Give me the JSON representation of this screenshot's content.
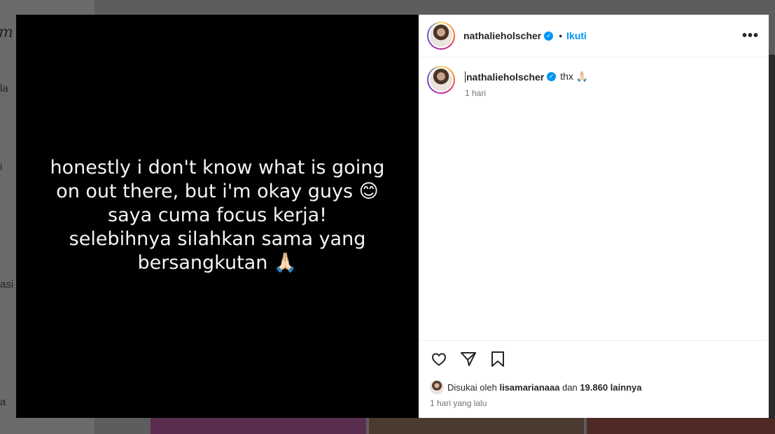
{
  "background": {
    "logo_fragment": "m",
    "nav_fragments": [
      "la",
      "i",
      "asi",
      "a"
    ]
  },
  "media": {
    "story_lines": [
      "honestly i don't know what is going",
      "on out there, but i'm okay guys 😊",
      "saya cuma focus kerja!",
      "selebihnya silahkan sama yang",
      "bersangkutan 🙏🏻"
    ]
  },
  "post": {
    "username": "nathalieholscher",
    "verified": true,
    "follow_label": "Ikuti",
    "more_label": "•••",
    "comment": {
      "username": "nathalieholscher",
      "text": "thx 🙏🏻",
      "time": "1 hari"
    },
    "likes": {
      "prefix": "Disukai oleh",
      "user": "lisamarianaaa",
      "conjunction": "dan",
      "count_text": "19.860 lainnya"
    },
    "posted_time": "1 hari yang lalu"
  },
  "icons": {
    "like": "heart-icon",
    "share": "send-icon",
    "save": "bookmark-icon",
    "verified": "verified-badge-icon"
  },
  "colors": {
    "accent": "#0095f6",
    "text": "#262626",
    "muted": "#737373",
    "overlay": "#5d5d5d"
  }
}
